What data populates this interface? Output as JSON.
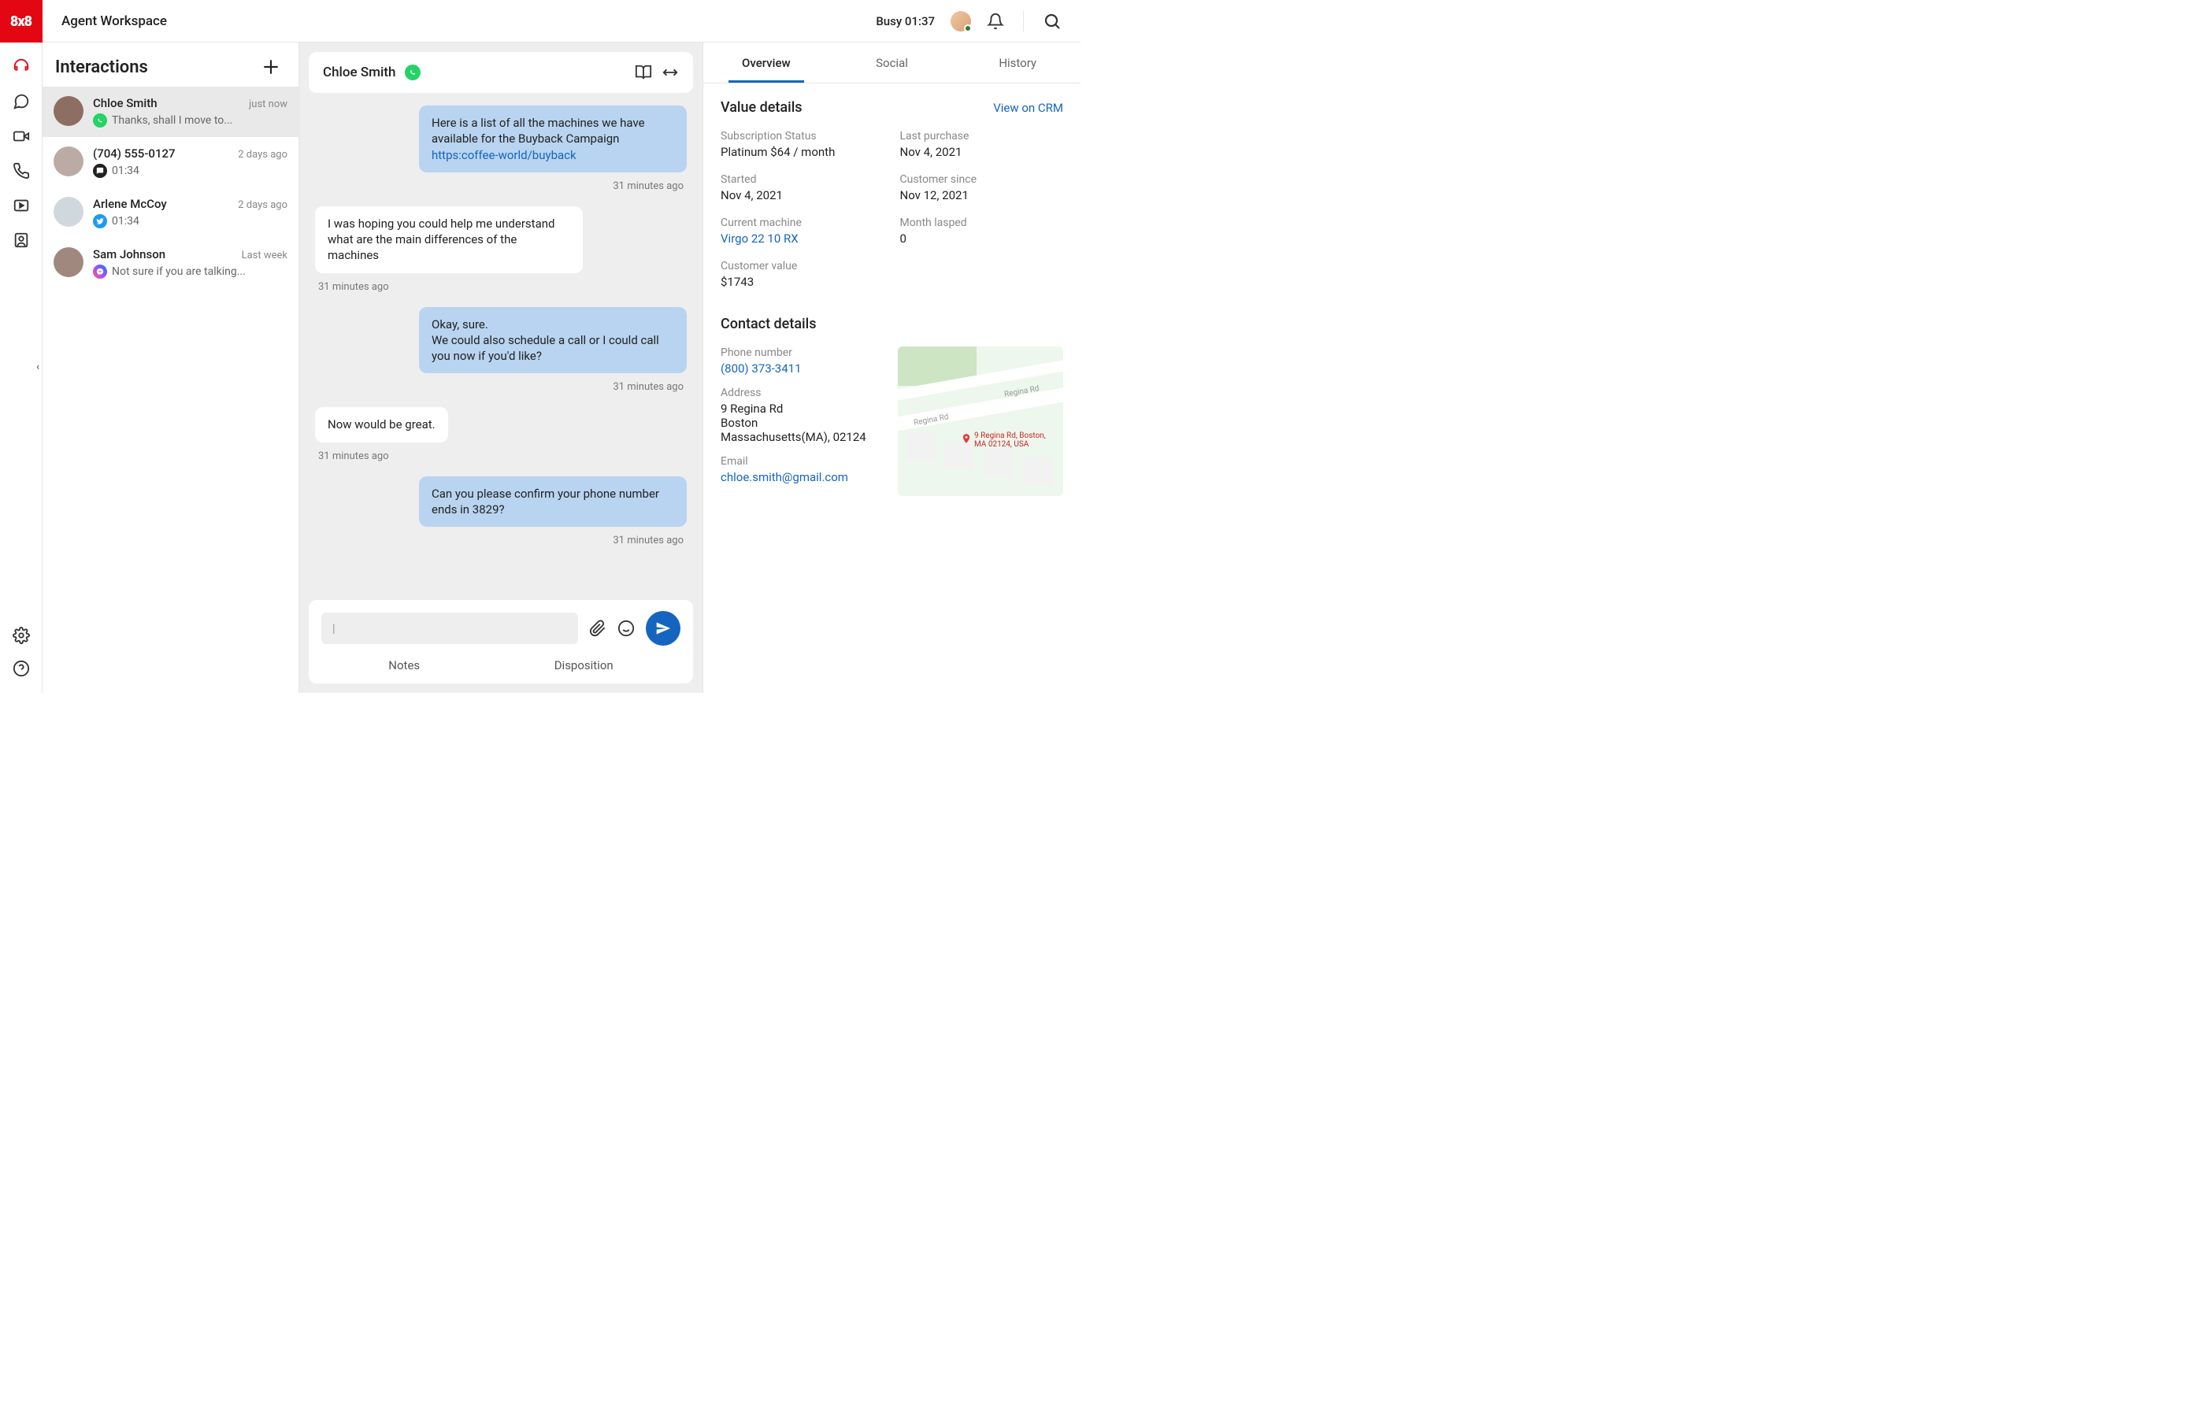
{
  "brand": "8x8",
  "header": {
    "title": "Agent Workspace",
    "status": "Busy 01:37"
  },
  "interactions": {
    "title": "Interactions",
    "items": [
      {
        "name": "Chloe Smith",
        "time": "just now",
        "channel": "whatsapp",
        "preview": "Thanks, shall I move to...",
        "avatar": "#8d6e63"
      },
      {
        "name": "(704) 555-0127",
        "time": "2 days ago",
        "channel": "sms",
        "preview": "01:34",
        "avatar": "#bcaaa4"
      },
      {
        "name": "Arlene McCoy",
        "time": "2 days ago",
        "channel": "twitter",
        "preview": "01:34",
        "avatar": "#cfd8dc"
      },
      {
        "name": "Sam Johnson",
        "time": "Last week",
        "channel": "messenger",
        "preview": "Not sure if you are talking...",
        "avatar": "#a1887f"
      }
    ]
  },
  "chat": {
    "contact": "Chloe Smith",
    "channel": "whatsapp",
    "messages": [
      {
        "dir": "out",
        "text": "Here is a list of all the machines we have available for the Buyback Campaign",
        "link": "https:coffee-world/buyback",
        "time": "31 minutes ago"
      },
      {
        "dir": "in",
        "text": "I was hoping you could help me understand what are the main differences of the machines",
        "time": "31 minutes ago"
      },
      {
        "dir": "out",
        "text": "Okay, sure.\nWe could also schedule a call or I could call you now if you'd like?",
        "time": "31 minutes ago"
      },
      {
        "dir": "in",
        "text": "Now would be great.",
        "time": "31 minutes ago"
      },
      {
        "dir": "out",
        "text": "Can you please confirm your phone number ends in 3829?",
        "time": "31 minutes ago"
      }
    ],
    "composer": {
      "placeholder": "|",
      "tabs": [
        "Notes",
        "Disposition"
      ]
    }
  },
  "side": {
    "tabs": [
      "Overview",
      "Social",
      "History"
    ],
    "value": {
      "title": "Value details",
      "crm": "View on CRM",
      "fields": {
        "sub_label": "Subscription Status",
        "sub_value": "Platinum   $64 / month",
        "last_label": "Last purchase",
        "last_value": "Nov 4, 2021",
        "start_label": "Started",
        "start_value": "Nov 4, 2021",
        "since_label": "Customer since",
        "since_value": "Nov 12, 2021",
        "mach_label": "Current machine",
        "mach_value": "Virgo 22 10 RX",
        "lapse_label": "Month lasped",
        "lapse_value": "0",
        "cval_label": "Customer value",
        "cval_value": "$1743"
      }
    },
    "contact": {
      "title": "Contact details",
      "phone_label": "Phone number",
      "phone_value": "(800) 373-3411",
      "addr_label": "Address",
      "addr_value": "9 Regina Rd\nBoston\nMassachusetts(MA), 02124",
      "email_label": "Email",
      "email_value": "chloe.smith@gmail.com",
      "map_label": "9 Regina Rd, Boston,\nMA 02124, USA",
      "map_streets": [
        "Regina Rd",
        "Regina Rd"
      ]
    }
  }
}
